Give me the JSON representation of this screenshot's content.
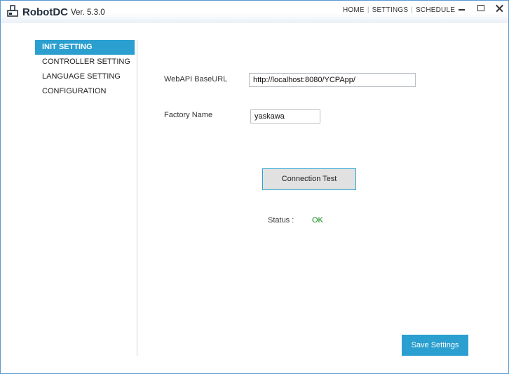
{
  "app": {
    "name": "RobotDC",
    "version": "Ver. 5.3.0"
  },
  "topnav": [
    "HOME",
    "SETTINGS",
    "SCHEDULE"
  ],
  "sidebar": {
    "items": [
      {
        "label": "INIT SETTING",
        "active": true
      },
      {
        "label": "CONTROLLER SETTING"
      },
      {
        "label": "LANGUAGE SETTING"
      },
      {
        "label": "CONFIGURATION"
      }
    ]
  },
  "form": {
    "webapi_label": "WebAPI BaseURL",
    "webapi_value": "http://localhost:8080/YCPApp/",
    "factory_label": "Factory Name",
    "factory_value": "yaskawa"
  },
  "buttons": {
    "connection_test": "Connection Test",
    "save_settings": "Save Settings"
  },
  "status": {
    "label": "Status :",
    "value": "OK"
  },
  "colors": {
    "accent": "#2a9fd0",
    "status_ok": "#0a8a0a"
  }
}
